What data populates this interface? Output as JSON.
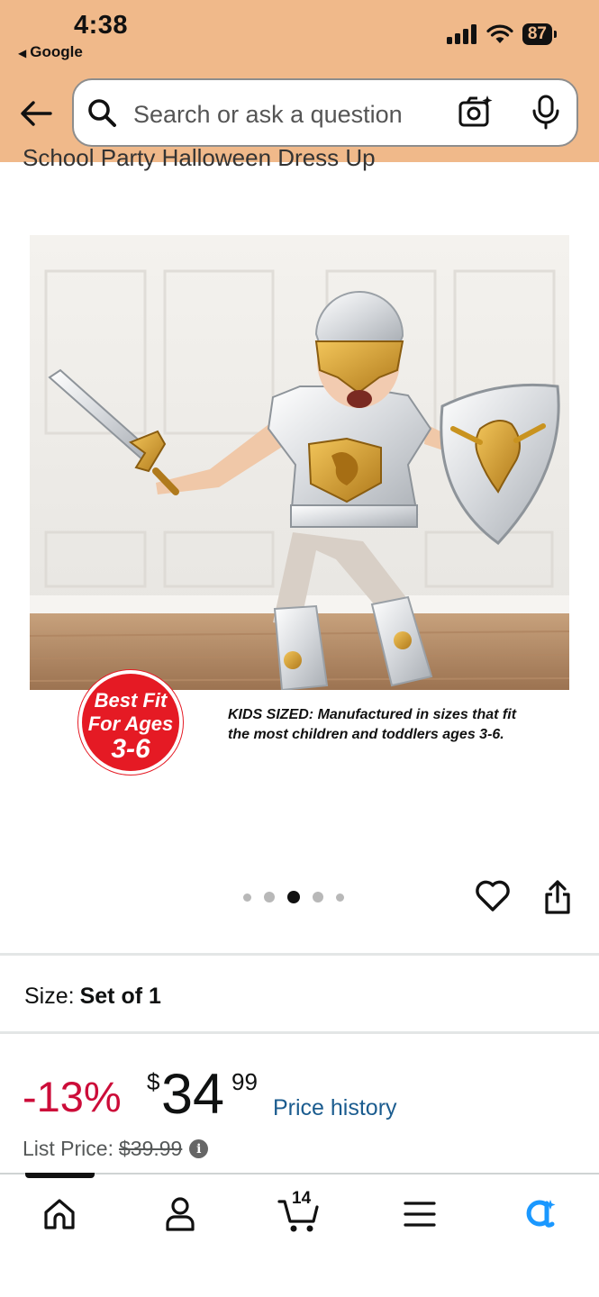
{
  "status_bar": {
    "time": "4:38",
    "back_app": "Google",
    "battery": "87"
  },
  "search": {
    "placeholder": "Search or ask a question"
  },
  "product": {
    "title_fragment": "School Party Halloween Dress Up",
    "image_badge": {
      "line1": "Best Fit",
      "line2": "For Ages",
      "line3": "3-6"
    },
    "image_caption": "KIDS SIZED: Manufactured in sizes that fit the most children and toddlers ages 3-6.",
    "carousel": {
      "count": 5,
      "active_index": 2
    }
  },
  "size": {
    "label": "Size:",
    "value": "Set of 1"
  },
  "price": {
    "discount": "-13%",
    "currency": "$",
    "whole": "34",
    "fraction": "99",
    "history_link": "Price history",
    "list_label": "List Price:",
    "list_value": "$39.99"
  },
  "bottom_nav": {
    "cart_count": "14",
    "items": [
      "home",
      "account",
      "cart",
      "menu",
      "rufus"
    ]
  },
  "colors": {
    "header_bg": "#f0b98a",
    "discount": "#cc0c39",
    "link": "#1b5c8f",
    "badge_red": "#e51a24",
    "rufus_blue": "#1a98ff"
  }
}
